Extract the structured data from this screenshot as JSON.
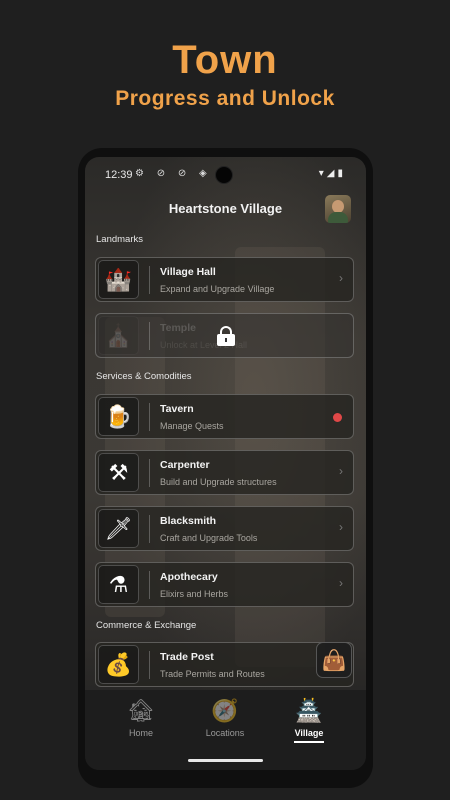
{
  "hero": {
    "title": "Town",
    "subtitle": "Progress and Unlock"
  },
  "status_bar": {
    "time": "12:39",
    "left_icons": "⚙ ⊘ ⊘ ◈",
    "right_icons": "▾◢▮"
  },
  "app_bar": {
    "title": "Heartstone Village",
    "avatar_icon": "hooded-character-avatar"
  },
  "sections": {
    "landmarks": "Landmarks",
    "services": "Services & Comodities",
    "commerce": "Commerce & Exchange"
  },
  "cards": [
    {
      "title": "Village Hall",
      "subtitle": "Expand and Upgrade Village",
      "icon": "village-hall-icon",
      "glyph": "🏰",
      "locked": false,
      "notification": false
    },
    {
      "title": "Temple",
      "subtitle": "Unlock at Level 2 Hall",
      "icon": "temple-icon",
      "glyph": "⛪",
      "locked": true,
      "notification": false
    },
    {
      "title": "Tavern",
      "subtitle": "Manage Quests",
      "icon": "beer-mug-icon",
      "glyph": "🍺",
      "locked": false,
      "notification": true
    },
    {
      "title": "Carpenter",
      "subtitle": "Build and Upgrade structures",
      "icon": "hammer-saw-icon",
      "glyph": "⚒",
      "locked": false,
      "notification": false
    },
    {
      "title": "Blacksmith",
      "subtitle": "Craft and Upgrade Tools",
      "icon": "anvil-tools-icon",
      "glyph": "🗡",
      "locked": false,
      "notification": false
    },
    {
      "title": "Apothecary",
      "subtitle": "Elixirs and Herbs",
      "icon": "potion-icon",
      "glyph": "⚗",
      "locked": false,
      "notification": false
    },
    {
      "title": "Trade Post",
      "subtitle": "Trade Permits and Routes",
      "icon": "coin-sack-icon",
      "glyph": "💰",
      "locked": false,
      "notification": false
    }
  ],
  "floating_button": {
    "icon": "satchel-icon",
    "glyph": "👜"
  },
  "nav": [
    {
      "label": "Home",
      "icon": "house-icon",
      "glyph": "🏚",
      "active": false
    },
    {
      "label": "Locations",
      "icon": "compass-icon",
      "glyph": "🧭",
      "active": false
    },
    {
      "label": "Village",
      "icon": "village-castle-icon",
      "glyph": "🏯",
      "active": true
    }
  ],
  "colors": {
    "accent": "#f0a24a",
    "notification": "#e04848",
    "background": "#1f1f1f"
  }
}
